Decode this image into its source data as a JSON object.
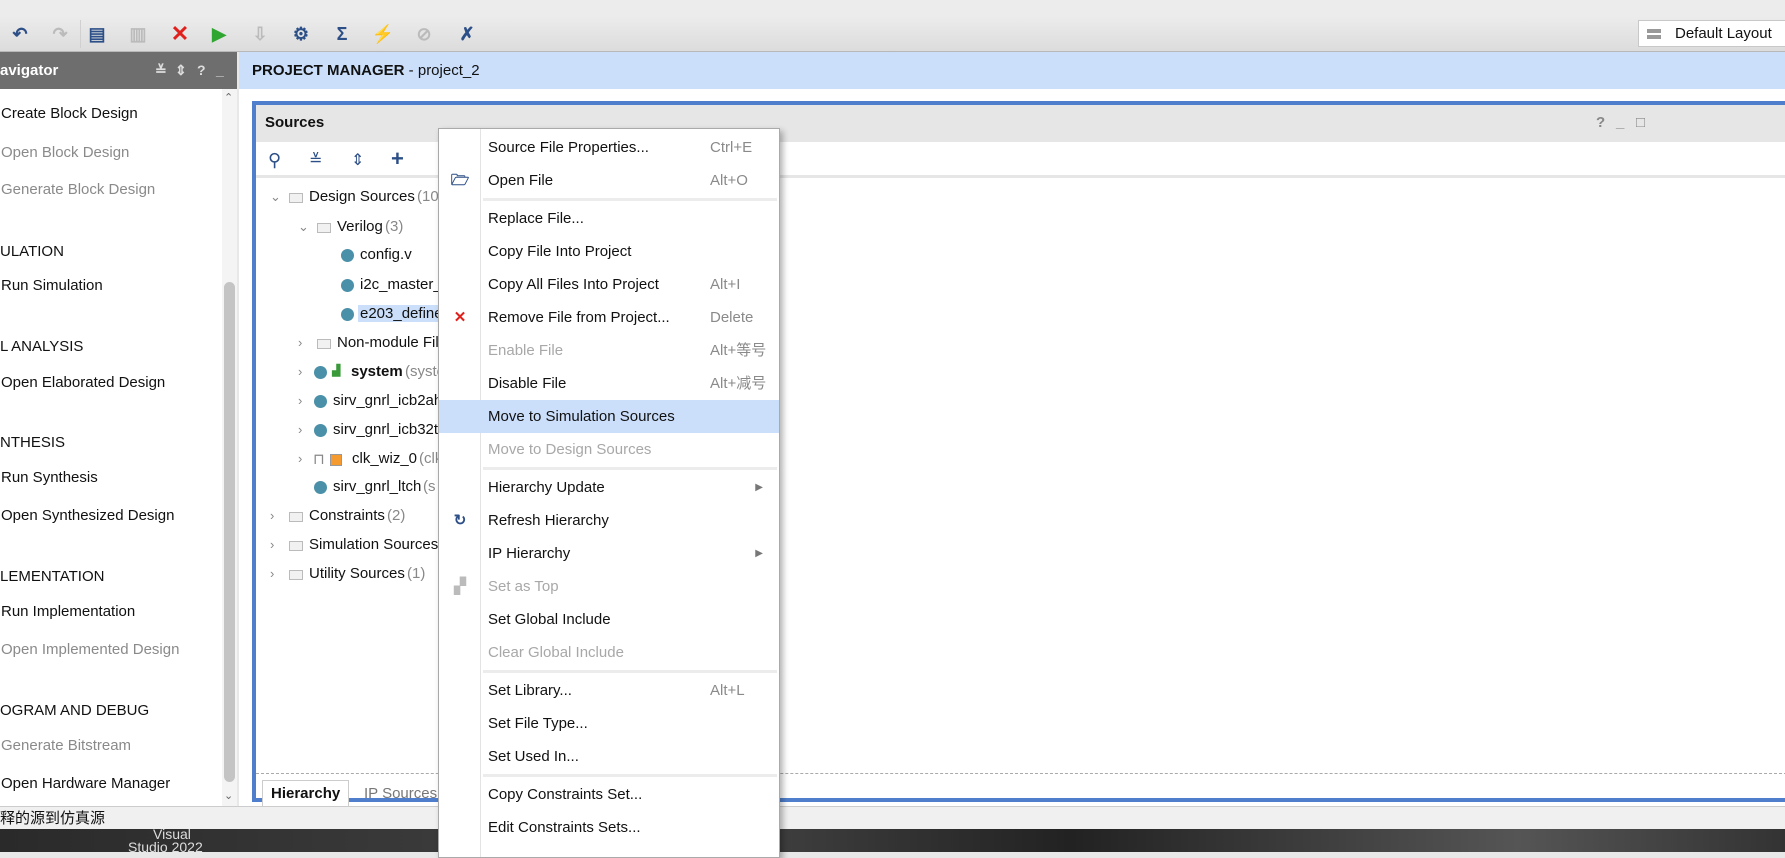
{
  "toolbar": {
    "icons": [
      "undo-icon",
      "redo-icon",
      "copy-icon",
      "paste-icon",
      "delete-icon",
      "run-icon",
      "step-icon",
      "settings-icon",
      "sigma-icon",
      "impl-icon",
      "debug-icon",
      "program-icon"
    ],
    "layout_label": "Default Layout"
  },
  "navigator": {
    "title": "avigator",
    "controls": [
      "≚",
      "⇕",
      "?",
      "_"
    ],
    "items": [
      {
        "label": "Create Block Design",
        "type": "item",
        "enabled": true
      },
      {
        "label": "Open Block Design",
        "type": "item",
        "enabled": false
      },
      {
        "label": "Generate Block Design",
        "type": "item",
        "enabled": false
      },
      {
        "label": "ULATION",
        "type": "section"
      },
      {
        "label": "Run Simulation",
        "type": "item",
        "enabled": true
      },
      {
        "label": "L ANALYSIS",
        "type": "section"
      },
      {
        "label": "Open Elaborated Design",
        "type": "item",
        "enabled": true
      },
      {
        "label": "NTHESIS",
        "type": "section"
      },
      {
        "label": "Run Synthesis",
        "type": "item",
        "enabled": true
      },
      {
        "label": "Open Synthesized Design",
        "type": "item",
        "enabled": true
      },
      {
        "label": "LEMENTATION",
        "type": "section"
      },
      {
        "label": "Run Implementation",
        "type": "item",
        "enabled": true
      },
      {
        "label": "Open Implemented Design",
        "type": "item",
        "enabled": false
      },
      {
        "label": "OGRAM AND DEBUG",
        "type": "section"
      },
      {
        "label": "Generate Bitstream",
        "type": "item",
        "enabled": false
      },
      {
        "label": "Open Hardware Manager",
        "type": "item",
        "enabled": true
      }
    ]
  },
  "header": {
    "title": "PROJECT MANAGER",
    "project": " - project_2"
  },
  "sources": {
    "title": "Sources",
    "panel_controls": [
      "?",
      "_",
      "□"
    ],
    "tree": [
      {
        "label": "Design Sources",
        "count": " (10)",
        "level": 0,
        "kind": "folder",
        "expanded": true
      },
      {
        "label": "Verilog",
        "count": " (3)",
        "level": 1,
        "kind": "folder",
        "expanded": true
      },
      {
        "label": "config.v",
        "count": "",
        "level": 2,
        "kind": "file"
      },
      {
        "label": "i2c_master_",
        "count": "",
        "level": 2,
        "kind": "file"
      },
      {
        "label": "e203_define",
        "count": "",
        "level": 2,
        "kind": "file",
        "selected": true
      },
      {
        "label": "Non-module File",
        "count": "",
        "level": 1,
        "kind": "folder"
      },
      {
        "label": "system",
        "count": " (syste",
        "level": 1,
        "kind": "top"
      },
      {
        "label": "sirv_gnrl_icb2ah",
        "count": "",
        "level": 1,
        "kind": "module"
      },
      {
        "label": "sirv_gnrl_icb32t",
        "count": "",
        "level": 1,
        "kind": "module"
      },
      {
        "label": "clk_wiz_0",
        "count": " (clk",
        "level": 1,
        "kind": "ip"
      },
      {
        "label": "sirv_gnrl_ltch",
        "count": " (s",
        "level": 1,
        "kind": "leaf"
      },
      {
        "label": "Constraints",
        "count": " (2)",
        "level": 0,
        "kind": "folder"
      },
      {
        "label": "Simulation Sources",
        "count": "",
        "level": 0,
        "kind": "folder"
      },
      {
        "label": "Utility Sources",
        "count": " (1)",
        "level": 0,
        "kind": "folder"
      }
    ],
    "tabs": [
      "Hierarchy",
      "IP Sources"
    ]
  },
  "context_menu": {
    "items": [
      {
        "label": "Source File Properties...",
        "shortcut": "Ctrl+E"
      },
      {
        "label": "Open File",
        "shortcut": "Alt+O",
        "icon": "folder-open-icon"
      },
      {
        "sep": true
      },
      {
        "label": "Replace File..."
      },
      {
        "label": "Copy File Into Project"
      },
      {
        "label": "Copy All Files Into Project",
        "shortcut": "Alt+I"
      },
      {
        "label": "Remove File from Project...",
        "shortcut": "Delete",
        "icon": "remove-icon"
      },
      {
        "label": "Enable File",
        "shortcut": "Alt+等号",
        "disabled": true
      },
      {
        "label": "Disable File",
        "shortcut": "Alt+减号"
      },
      {
        "label": "Move to Simulation Sources",
        "highlighted": true
      },
      {
        "label": "Move to Design Sources",
        "disabled": true
      },
      {
        "sep": true
      },
      {
        "label": "Hierarchy Update",
        "submenu": true
      },
      {
        "label": "Refresh Hierarchy",
        "icon": "refresh-icon"
      },
      {
        "label": "IP Hierarchy",
        "submenu": true
      },
      {
        "label": "Set as Top",
        "disabled": true,
        "icon": "hierarchy-icon"
      },
      {
        "label": "Set Global Include"
      },
      {
        "label": "Clear Global Include",
        "disabled": true
      },
      {
        "sep": true
      },
      {
        "label": "Set Library...",
        "shortcut": "Alt+L"
      },
      {
        "label": "Set File Type..."
      },
      {
        "label": "Set Used In..."
      },
      {
        "sep": true
      },
      {
        "label": "Copy Constraints Set..."
      },
      {
        "label": "Edit Constraints Sets..."
      }
    ]
  },
  "status_bar": {
    "text": "释的源到仿真源"
  },
  "taskbar": {
    "items": [
      "Visual",
      "Studio 2022"
    ]
  },
  "colors": {
    "accent": "#4f7fcc",
    "header_bg": "#cbdffb",
    "highlight": "#cbdffb",
    "nav_header": "#6e6e6e",
    "file_dot": "#4a90a8",
    "remove_red": "#e0201c"
  }
}
